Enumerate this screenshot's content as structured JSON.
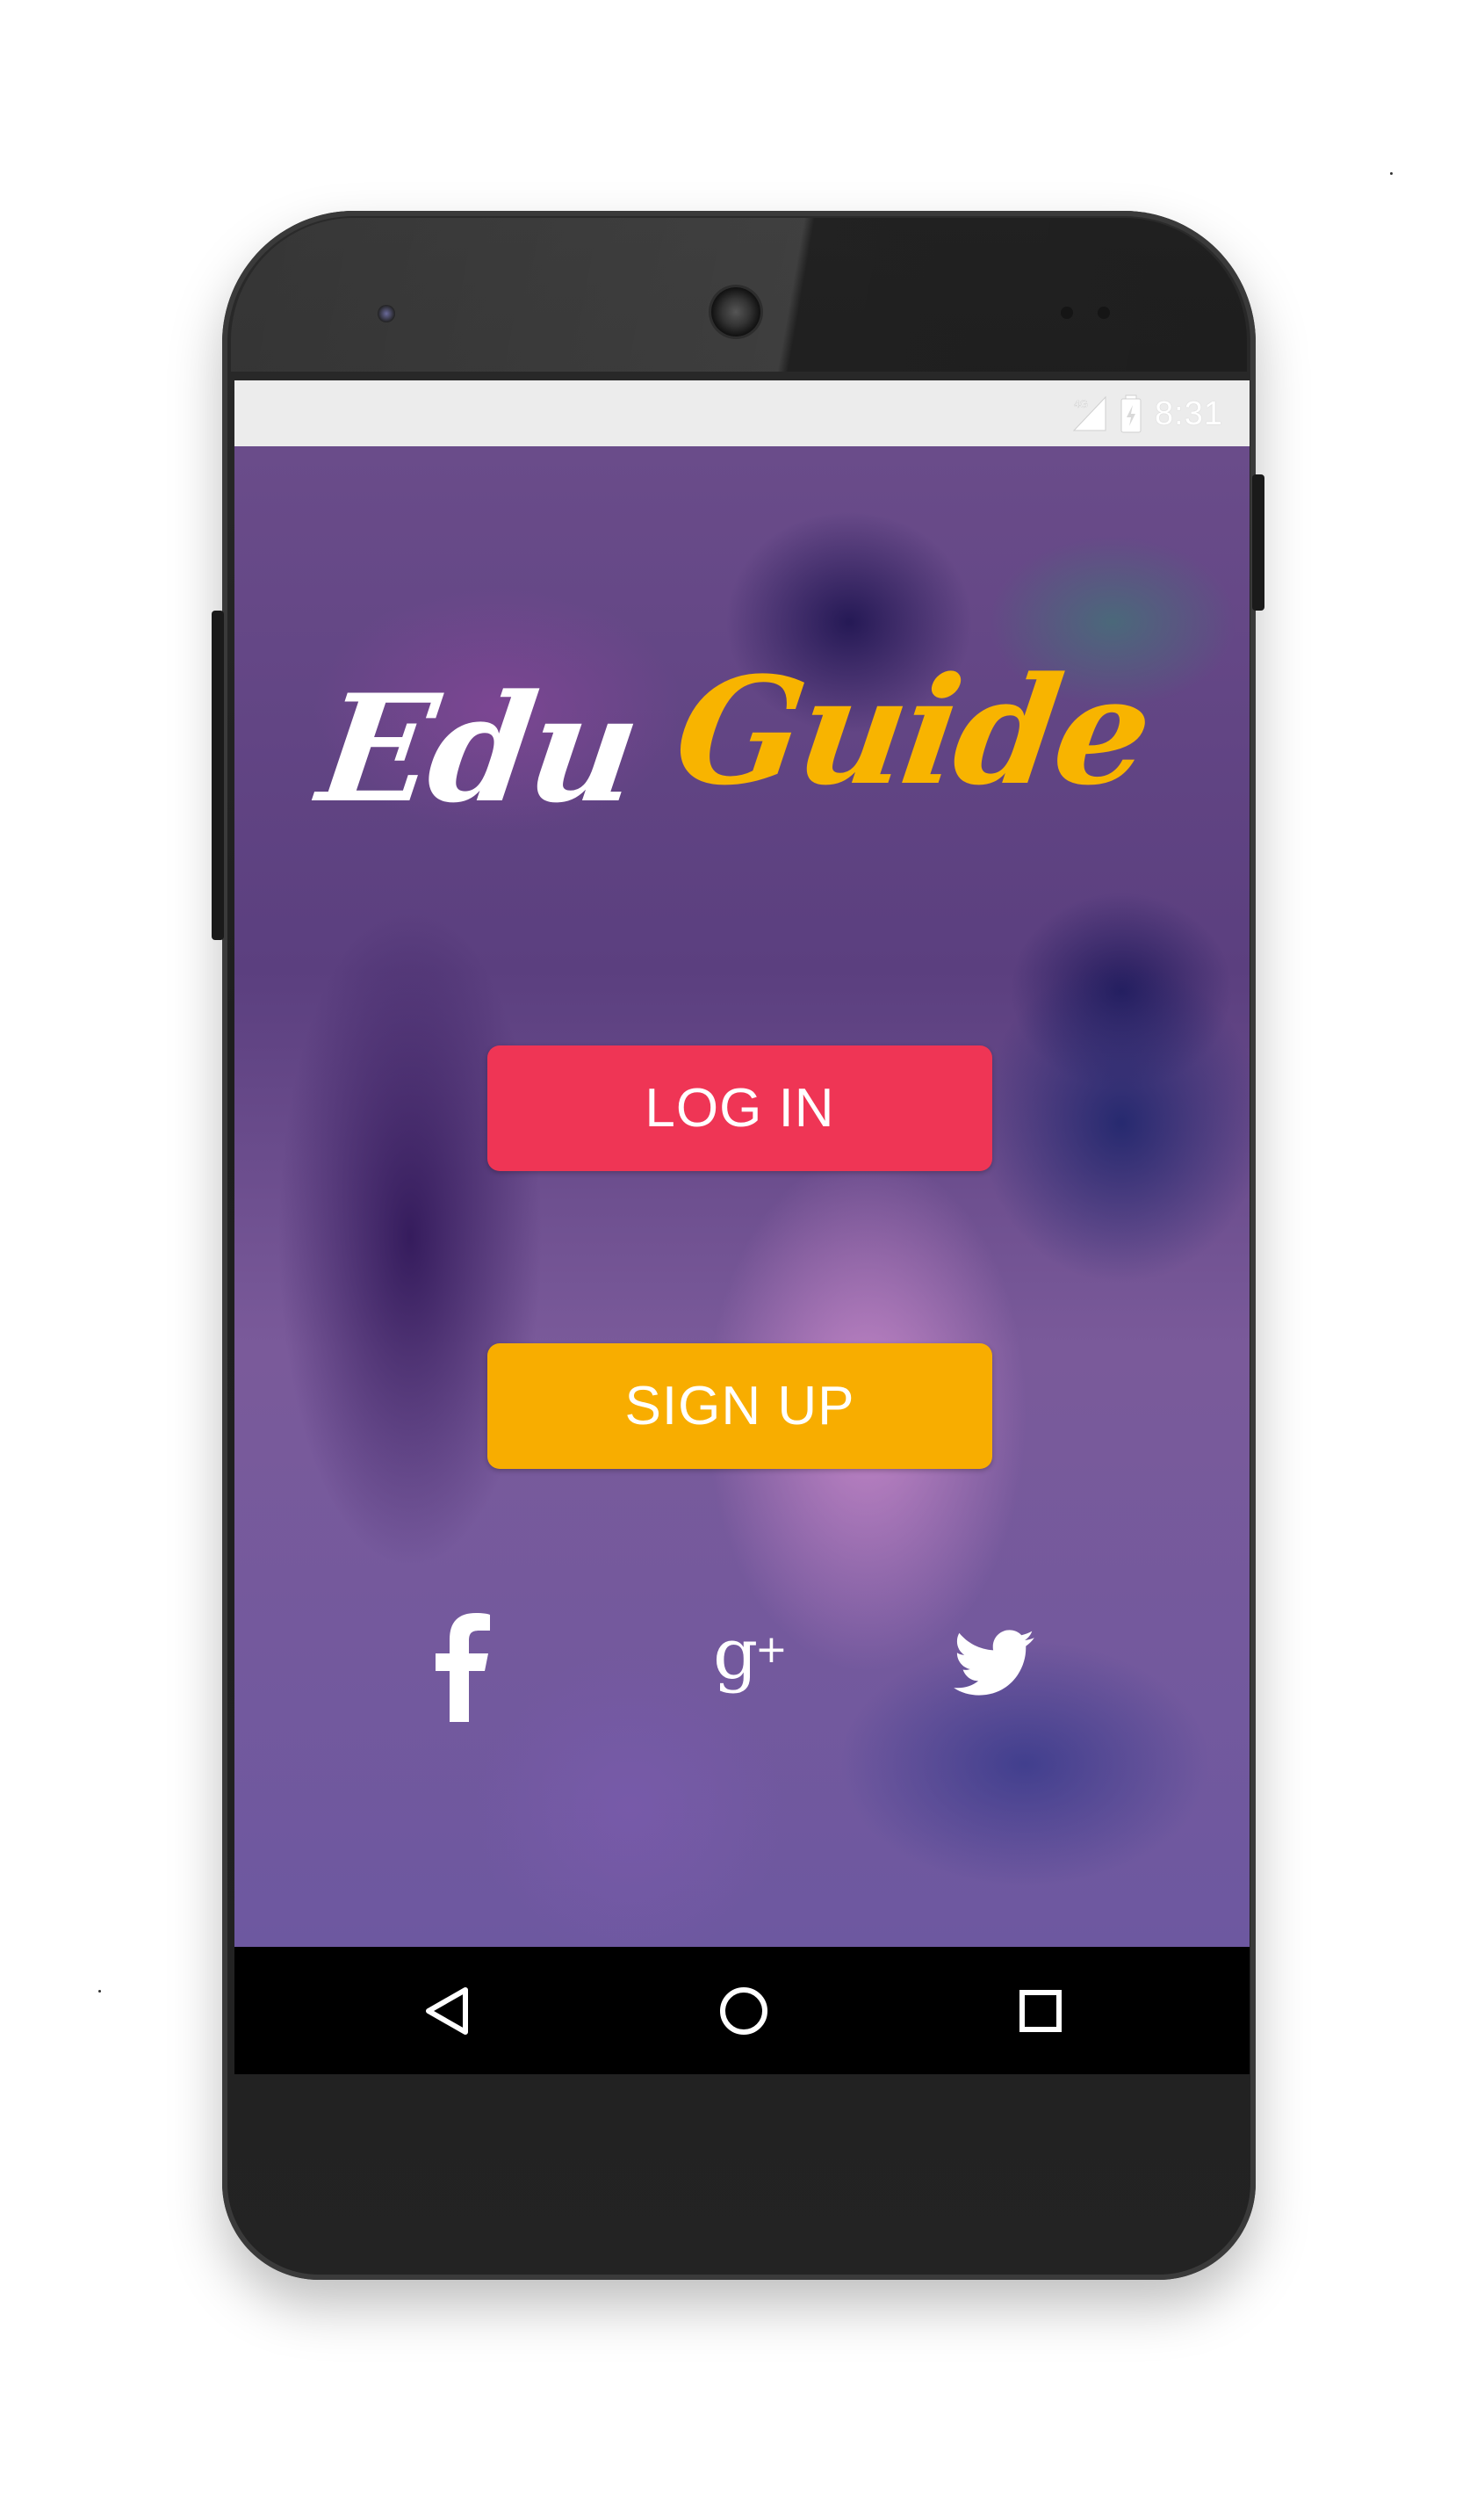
{
  "status_bar": {
    "network": "4G",
    "time": "8:31"
  },
  "logo": {
    "part1": "Edu",
    "part2": "Guide"
  },
  "buttons": {
    "login_label": "LOG IN",
    "signup_label": "SIGN UP"
  },
  "social": [
    {
      "name": "facebook-icon"
    },
    {
      "name": "google-plus-icon"
    },
    {
      "name": "twitter-icon"
    }
  ],
  "nav_bar": {
    "back": "back-icon",
    "home": "home-icon",
    "recents": "recents-icon"
  },
  "colors": {
    "login": "#ef3555",
    "signup": "#f8ad00",
    "logo_accent": "#f8b400",
    "status_bar_bg": "#ececec"
  }
}
